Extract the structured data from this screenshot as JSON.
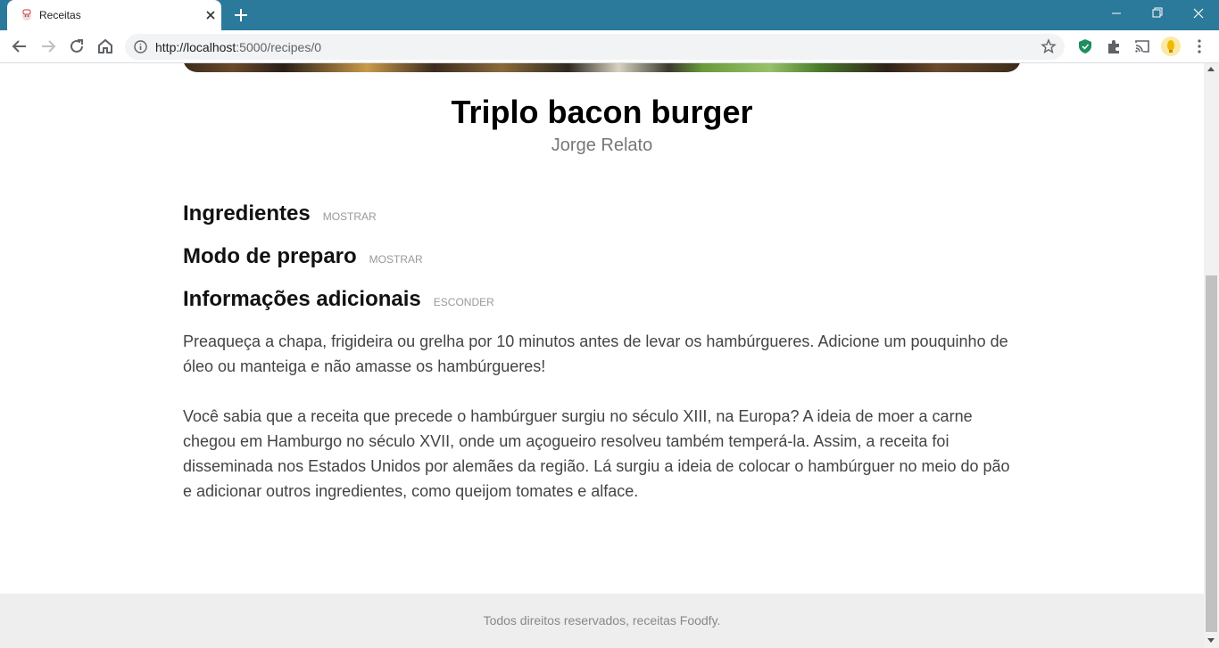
{
  "browser": {
    "tab_title": "Receitas",
    "url_host": "http://localhost",
    "url_path": ":5000/recipes/0"
  },
  "recipe": {
    "title": "Triplo bacon burger",
    "author": "Jorge Relato"
  },
  "sections": {
    "ingredientes": {
      "title": "Ingredientes",
      "toggle": "MOSTRAR"
    },
    "modo": {
      "title": "Modo de preparo",
      "toggle": "MOSTRAR"
    },
    "info": {
      "title": "Informações adicionais",
      "toggle": "ESCONDER"
    }
  },
  "info_paragraphs": [
    "Preaqueça a chapa, frigideira ou grelha por 10 minutos antes de levar os hambúrgueres. Adicione um pouquinho de óleo ou manteiga e não amasse os hambúrgueres!",
    "Você sabia que a receita que precede o hambúrguer surgiu no século XIII, na Europa? A ideia de moer a carne chegou em Hamburgo no século XVII, onde um açogueiro resolveu também temperá-la. Assim, a receita foi disseminada nos Estados Unidos por alemães da região. Lá surgiu a ideia de colocar o hambúrguer no meio do pão e adicionar outros ingredientes, como queijom tomates e alface."
  ],
  "footer": {
    "text": "Todos direitos reservados, receitas Foodfy."
  },
  "colors": {
    "tabbar": "#2c7a9b",
    "footer_bg": "#eeeeee",
    "toggle_text": "#999999"
  }
}
